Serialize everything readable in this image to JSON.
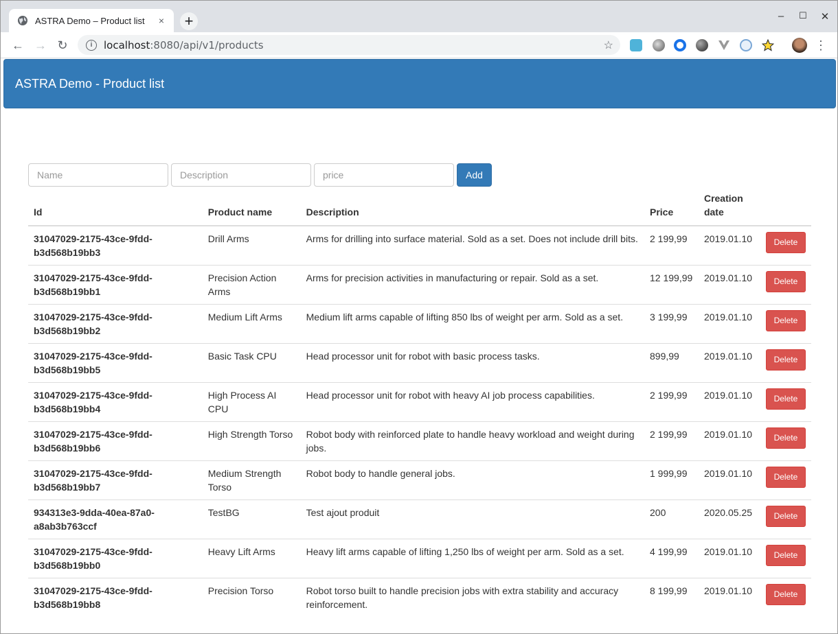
{
  "browser": {
    "tab_title": "ASTRA Demo – Product list",
    "tab_close": "×",
    "new_tab": "+",
    "url_host": "localhost",
    "url_rest": ":8080/api/v1/products",
    "minimize": "–",
    "maximize": "☐",
    "close": "✕",
    "back": "←",
    "forward": "→",
    "reload": "↻",
    "bookmark_star": "☆",
    "menu": "⋮"
  },
  "navbar": {
    "brand": "ASTRA Demo - Product list"
  },
  "form": {
    "name_placeholder": "Name",
    "description_placeholder": "Description",
    "price_placeholder": "price",
    "add_label": "Add"
  },
  "table": {
    "headers": {
      "id": "Id",
      "name": "Product name",
      "description": "Description",
      "price": "Price",
      "creation_date": "Creation date"
    },
    "delete_label": "Delete",
    "rows": [
      {
        "id": "31047029-2175-43ce-9fdd-b3d568b19bb3",
        "name": "Drill Arms",
        "description": "Arms for drilling into surface material. Sold as a set. Does not include drill bits.",
        "price": "2 199,99",
        "date": "2019.01.10"
      },
      {
        "id": "31047029-2175-43ce-9fdd-b3d568b19bb1",
        "name": "Precision Action Arms",
        "description": "Arms for precision activities in manufacturing or repair. Sold as a set.",
        "price": "12 199,99",
        "date": "2019.01.10"
      },
      {
        "id": "31047029-2175-43ce-9fdd-b3d568b19bb2",
        "name": "Medium Lift Arms",
        "description": "Medium lift arms capable of lifting 850 lbs of weight per arm. Sold as a set.",
        "price": "3 199,99",
        "date": "2019.01.10"
      },
      {
        "id": "31047029-2175-43ce-9fdd-b3d568b19bb5",
        "name": "Basic Task CPU",
        "description": "Head processor unit for robot with basic process tasks.",
        "price": "899,99",
        "date": "2019.01.10"
      },
      {
        "id": "31047029-2175-43ce-9fdd-b3d568b19bb4",
        "name": "High Process AI CPU",
        "description": "Head processor unit for robot with heavy AI job process capabilities.",
        "price": "2 199,99",
        "date": "2019.01.10"
      },
      {
        "id": "31047029-2175-43ce-9fdd-b3d568b19bb6",
        "name": "High Strength Torso",
        "description": "Robot body with reinforced plate to handle heavy workload and weight during jobs.",
        "price": "2 199,99",
        "date": "2019.01.10"
      },
      {
        "id": "31047029-2175-43ce-9fdd-b3d568b19bb7",
        "name": "Medium Strength Torso",
        "description": "Robot body to handle general jobs.",
        "price": "1 999,99",
        "date": "2019.01.10"
      },
      {
        "id": "934313e3-9dda-40ea-87a0-a8ab3b763ccf",
        "name": "TestBG",
        "description": "Test ajout produit",
        "price": "200",
        "date": "2020.05.25"
      },
      {
        "id": "31047029-2175-43ce-9fdd-b3d568b19bb0",
        "name": "Heavy Lift Arms",
        "description": "Heavy lift arms capable of lifting 1,250 lbs of weight per arm. Sold as a set.",
        "price": "4 199,99",
        "date": "2019.01.10"
      },
      {
        "id": "31047029-2175-43ce-9fdd-b3d568b19bb8",
        "name": "Precision Torso",
        "description": "Robot torso built to handle precision jobs with extra stability and accuracy reinforcement.",
        "price": "8 199,99",
        "date": "2019.01.10"
      }
    ]
  },
  "colors": {
    "navbar": "#337ab7",
    "delete": "#d9534f",
    "add": "#337ab7"
  },
  "icons": {
    "tab": "globe-icon",
    "omnibox": "info-icon",
    "extensions": [
      "cookie-extension-icon",
      "grey-ball-extension-icon",
      "blue-ring-extension-icon",
      "balls-extension-icon",
      "vue-extension-icon",
      "react-extension-icon",
      "star-extension-icon"
    ]
  }
}
